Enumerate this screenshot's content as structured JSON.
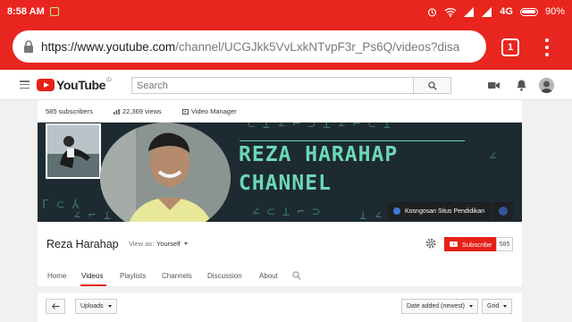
{
  "status_bar": {
    "time": "8:58 AM",
    "network": "4G",
    "battery": "90%"
  },
  "browser": {
    "url_host": "https://www.youtube.com",
    "url_path": "/channel/UCGJkk5VvLxkNTvpF3r_Ps6Q/videos?disa",
    "tab_count": "1"
  },
  "masthead": {
    "logo_text": "YouTube",
    "logo_region": "ID",
    "search_placeholder": "Search"
  },
  "stats": {
    "subscribers": "585 subscribers",
    "views": "22,369 views",
    "video_manager": "Video Manager"
  },
  "banner": {
    "title_line1": "REZA HARAHAP",
    "title_line2": "CHANNEL",
    "featured_link": "Kosngosan Situs Pendidikan"
  },
  "channel": {
    "name": "Reza Harahap",
    "view_as_label": "View as:",
    "view_as_value": "Yourself",
    "subscribe_label": "Subscribe",
    "subscriber_count": "585"
  },
  "tabs": [
    {
      "label": "Home"
    },
    {
      "label": "Videos",
      "active": true
    },
    {
      "label": "Playlists"
    },
    {
      "label": "Channels"
    },
    {
      "label": "Discussion"
    },
    {
      "label": "About"
    }
  ],
  "toolbar": {
    "uploads": "Uploads",
    "sort": "Date added (newest)",
    "view": "Grid"
  },
  "colors": {
    "browser_red": "#e8261f",
    "youtube_red": "#e62117",
    "banner_teal": "#6cd7b6",
    "banner_bg": "#1d2a31"
  }
}
